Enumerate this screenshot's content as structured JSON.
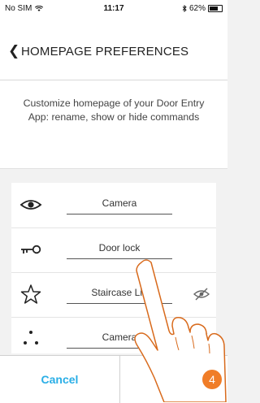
{
  "status_bar": {
    "carrier": "No SIM",
    "time": "11:17",
    "battery": "62%",
    "wifi_icon": "wifi-icon",
    "bluetooth_icon": "bluetooth-icon"
  },
  "header": {
    "title": "HOMEPAGE PREFERENCES",
    "back_icon": "chevron-left-icon"
  },
  "intro": {
    "text": "Customize homepage of your Door Entry App: rename, show or hide commands"
  },
  "commands": [
    {
      "label": "Camera",
      "icon": "eye-icon",
      "visible": true
    },
    {
      "label": "Door lock",
      "icon": "key-icon",
      "visible": true
    },
    {
      "label": "Staircase Lig",
      "icon": "star-icon",
      "visible": true
    },
    {
      "label": "Camera",
      "icon": "camera-dots-icon",
      "visible": false
    }
  ],
  "footer": {
    "cancel_label": "Cancel",
    "next_label": "›",
    "step_number": "4"
  },
  "colors": {
    "accent": "#29aee6",
    "step_badge": "#f07d28"
  }
}
